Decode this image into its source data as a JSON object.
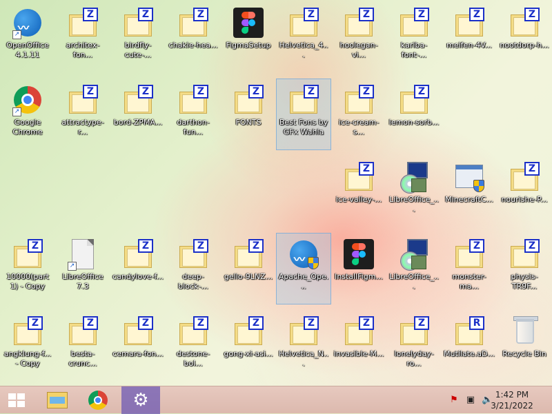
{
  "desktop": {
    "icons": [
      {
        "label": "OpenOffice 4.1.11",
        "type": "openoffice",
        "shortcut": true
      },
      {
        "label": "architex-fon...",
        "type": "font"
      },
      {
        "label": "birdfly-cute-...",
        "type": "font"
      },
      {
        "label": "chakie-hea...",
        "type": "font"
      },
      {
        "label": "FigmaSetup",
        "type": "figma"
      },
      {
        "label": "Helvetica_4...",
        "type": "font"
      },
      {
        "label": "hoolegan-vi...",
        "type": "font"
      },
      {
        "label": "kariba-font-...",
        "type": "font"
      },
      {
        "label": "meifen-4V...",
        "type": "font"
      },
      {
        "label": "nootdorp-h...",
        "type": "font"
      },
      {
        "label": "Google Chrome",
        "type": "chrome",
        "shortcut": true
      },
      {
        "label": "attractype-r...",
        "type": "font"
      },
      {
        "label": "bord-ZPMA...",
        "type": "font"
      },
      {
        "label": "darthon-fun...",
        "type": "font"
      },
      {
        "label": "FONTS",
        "type": "font"
      },
      {
        "label": "Best Fons by GFx Wahla",
        "type": "font",
        "selected": true
      },
      {
        "label": "ice-cream-s...",
        "type": "font"
      },
      {
        "label": "lemon-sorb...",
        "type": "font"
      },
      {
        "label": "ice-valley-...",
        "type": "font"
      },
      {
        "label": "LibreOffice_...",
        "type": "installer"
      },
      {
        "label": "MinecraftC...",
        "type": "winapp"
      },
      {
        "label": "nourishe-P...",
        "type": "font"
      },
      {
        "label": "10000(part 1) - Copy",
        "type": "font"
      },
      {
        "label": "LibreOffice 7.3",
        "type": "libreoffice",
        "shortcut": true
      },
      {
        "label": "candylove-f...",
        "type": "font"
      },
      {
        "label": "deep-block-...",
        "type": "font"
      },
      {
        "label": "gello-9LNZ...",
        "type": "font"
      },
      {
        "label": "Apache_Ope...",
        "type": "openoffice-setup",
        "selected": true
      },
      {
        "label": "InstallFigm...",
        "type": "figma"
      },
      {
        "label": "LibreOffice_...",
        "type": "installer"
      },
      {
        "label": "monster-ma...",
        "type": "font"
      },
      {
        "label": "physis-TR9F...",
        "type": "font"
      },
      {
        "label": "angklung-f... - Copy",
        "type": "font"
      },
      {
        "label": "besta-crunc...",
        "type": "font"
      },
      {
        "label": "cemara-fon...",
        "type": "font"
      },
      {
        "label": "destone-bol...",
        "type": "font"
      },
      {
        "label": "gong-xi-asi...",
        "type": "font"
      },
      {
        "label": "Helvetica_N...",
        "type": "font"
      },
      {
        "label": "invasible-M...",
        "type": "font"
      },
      {
        "label": "lonelyday-ro...",
        "type": "font"
      },
      {
        "label": "Mutilate.aD...",
        "type": "font-r"
      },
      {
        "label": "Recycle Bin",
        "type": "recycle"
      }
    ]
  },
  "taskbar": {
    "clock_time": "1:42 PM",
    "clock_date": "3/21/2022"
  }
}
